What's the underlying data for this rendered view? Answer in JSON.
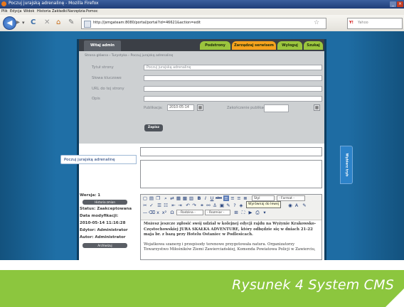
{
  "window": {
    "title": "Poczuj jurajską adrenalinę - Mozilla Firefox",
    "minimize": "_",
    "close": "×"
  },
  "menu": [
    "Plik",
    "Edycja",
    "Widok",
    "Historia",
    "Zakładki",
    "Narzędzia",
    "Pomoc"
  ],
  "nav": {
    "back_icon": "back-arrow-icon",
    "back_glyph": "◀",
    "forward_glyph": "▸",
    "dropdown_glyph": "▾",
    "reload_glyph": "C",
    "stop_glyph": "✕",
    "home_glyph": "⌂",
    "bookmark_glyph": "✎",
    "url": "http://jsmgateam:8080/portal/portal?id=46621&action=edit",
    "star_glyph": "☆",
    "search_engine": "Y!",
    "search_placeholder": "Yahoo"
  },
  "tabs": {
    "welcome": "Witaj admin",
    "subpages": "Podstrony",
    "manage": "Zarządzaj serwisem",
    "logout": "Wyloguj",
    "tools": "Szukaj"
  },
  "form": {
    "breadcrumb": "Strona główna › Turystyka › Poczuj jurajską adrenalinę",
    "labels": {
      "page_title": "Tytuł strony",
      "keywords": "Słowa kluczowe",
      "url": "URL do tej strony",
      "description": "Opis"
    },
    "values": {
      "page_title": "Poczuj jurajską adrenalinę",
      "keywords": "",
      "url": "",
      "description": ""
    },
    "publication_label": "Publikacja:",
    "publication_date": "2010-05-14",
    "end_publication_label": "Zakończenie publikacji:",
    "save_button": "Zapisz",
    "calendar_glyph": "▦"
  },
  "floating_title": "Poczuj jurajską adrenalinę",
  "side_tab": "Wybierz tryb",
  "meta": {
    "version_label": "Wersja: 1",
    "history_button": "Historia zmian",
    "status": "Status: Zaakceptowana",
    "modified_label": "Data modyfikacji:",
    "modified_value": "2010-05-14 11:16:28",
    "editor": "Edytor: Administrator",
    "author": "Autor: Administrator",
    "archive_button": "Archiwizuj"
  },
  "editor": {
    "tooltip": "Wyrównaj do lewej",
    "style_select": "Styl",
    "format_select": "- Format -",
    "font_select": "- Rodzina -",
    "size_select": "- Rozmiar -",
    "paragraph1": "Możesz jeszcze zgłosić swój udział w kolejnej edycji rajdu na Wyżynie Krakowsko-Częstochowskiej JURA SKAŁKA ADVENTURE, który odbędzie się w dniach 21-22 maja br. z bazą przy Hotelu Ostaniec w Podlesicach.",
    "paragraph2": "Wojatkowa szanerg i przepisody terenowe przygotowała natura. Organizatorzy Towarzystwo Miłośników Ziemi Zawierciańskiej, Komenda Powiatowa Policji w Zawierciu,"
  },
  "caption": "Rysunek 4 System CMS"
}
